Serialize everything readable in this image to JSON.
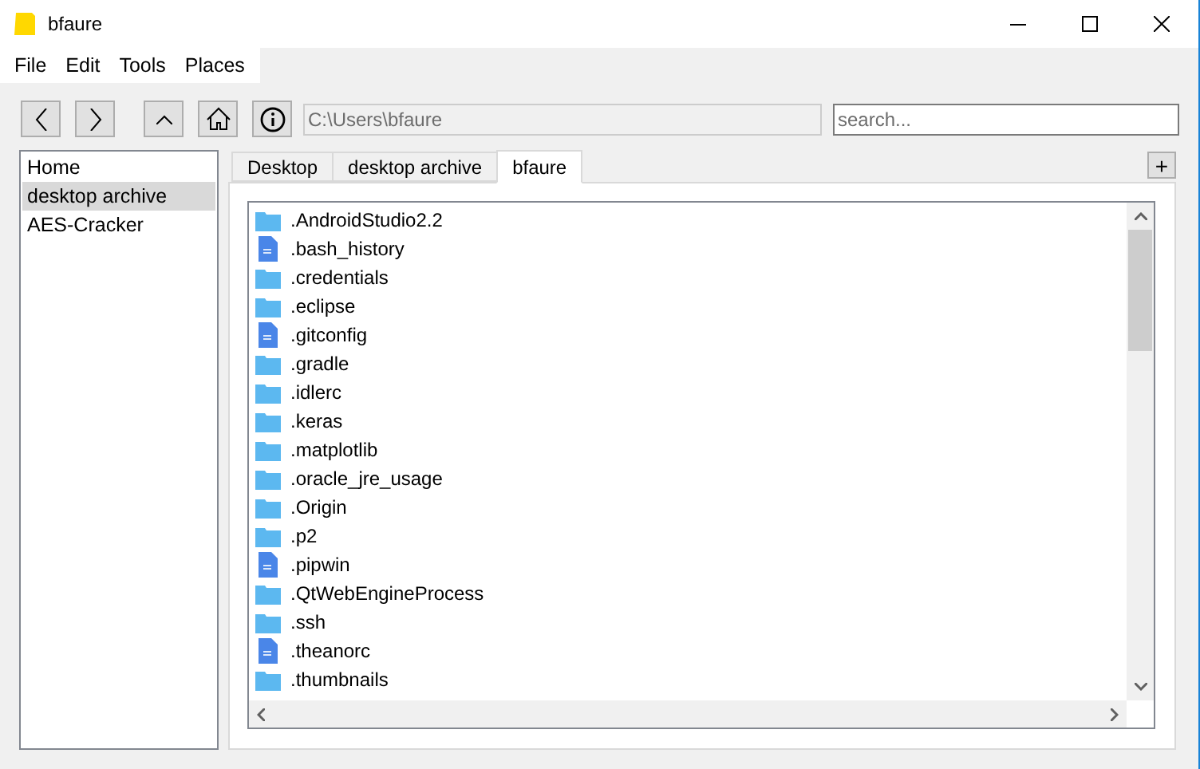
{
  "window": {
    "title": "bfaure"
  },
  "menu": [
    "File",
    "Edit",
    "Tools",
    "Places"
  ],
  "toolbar": {
    "path": "C:\\Users\\bfaure",
    "search": {
      "placeholder": "search..."
    },
    "new_tab": "+"
  },
  "sidebar": {
    "items": [
      {
        "label": "Home",
        "selected": false
      },
      {
        "label": "desktop archive",
        "selected": true
      },
      {
        "label": "AES-Cracker",
        "selected": false
      }
    ]
  },
  "tabs": [
    {
      "label": "Desktop",
      "selected": false
    },
    {
      "label": "desktop archive",
      "selected": false
    },
    {
      "label": "bfaure",
      "selected": true
    }
  ],
  "files": [
    {
      "name": ".AndroidStudio2.2",
      "kind": "folder"
    },
    {
      "name": ".bash_history",
      "kind": "file"
    },
    {
      "name": ".credentials",
      "kind": "folder"
    },
    {
      "name": ".eclipse",
      "kind": "folder"
    },
    {
      "name": ".gitconfig",
      "kind": "file"
    },
    {
      "name": ".gradle",
      "kind": "folder"
    },
    {
      "name": ".idlerc",
      "kind": "folder"
    },
    {
      "name": ".keras",
      "kind": "folder"
    },
    {
      "name": ".matplotlib",
      "kind": "folder"
    },
    {
      "name": ".oracle_jre_usage",
      "kind": "folder"
    },
    {
      "name": ".Origin",
      "kind": "folder"
    },
    {
      "name": ".p2",
      "kind": "folder"
    },
    {
      "name": ".pipwin",
      "kind": "file"
    },
    {
      "name": ".QtWebEngineProcess",
      "kind": "folder"
    },
    {
      "name": ".ssh",
      "kind": "folder"
    },
    {
      "name": ".theanorc",
      "kind": "file"
    },
    {
      "name": ".thumbnails",
      "kind": "folder"
    }
  ]
}
